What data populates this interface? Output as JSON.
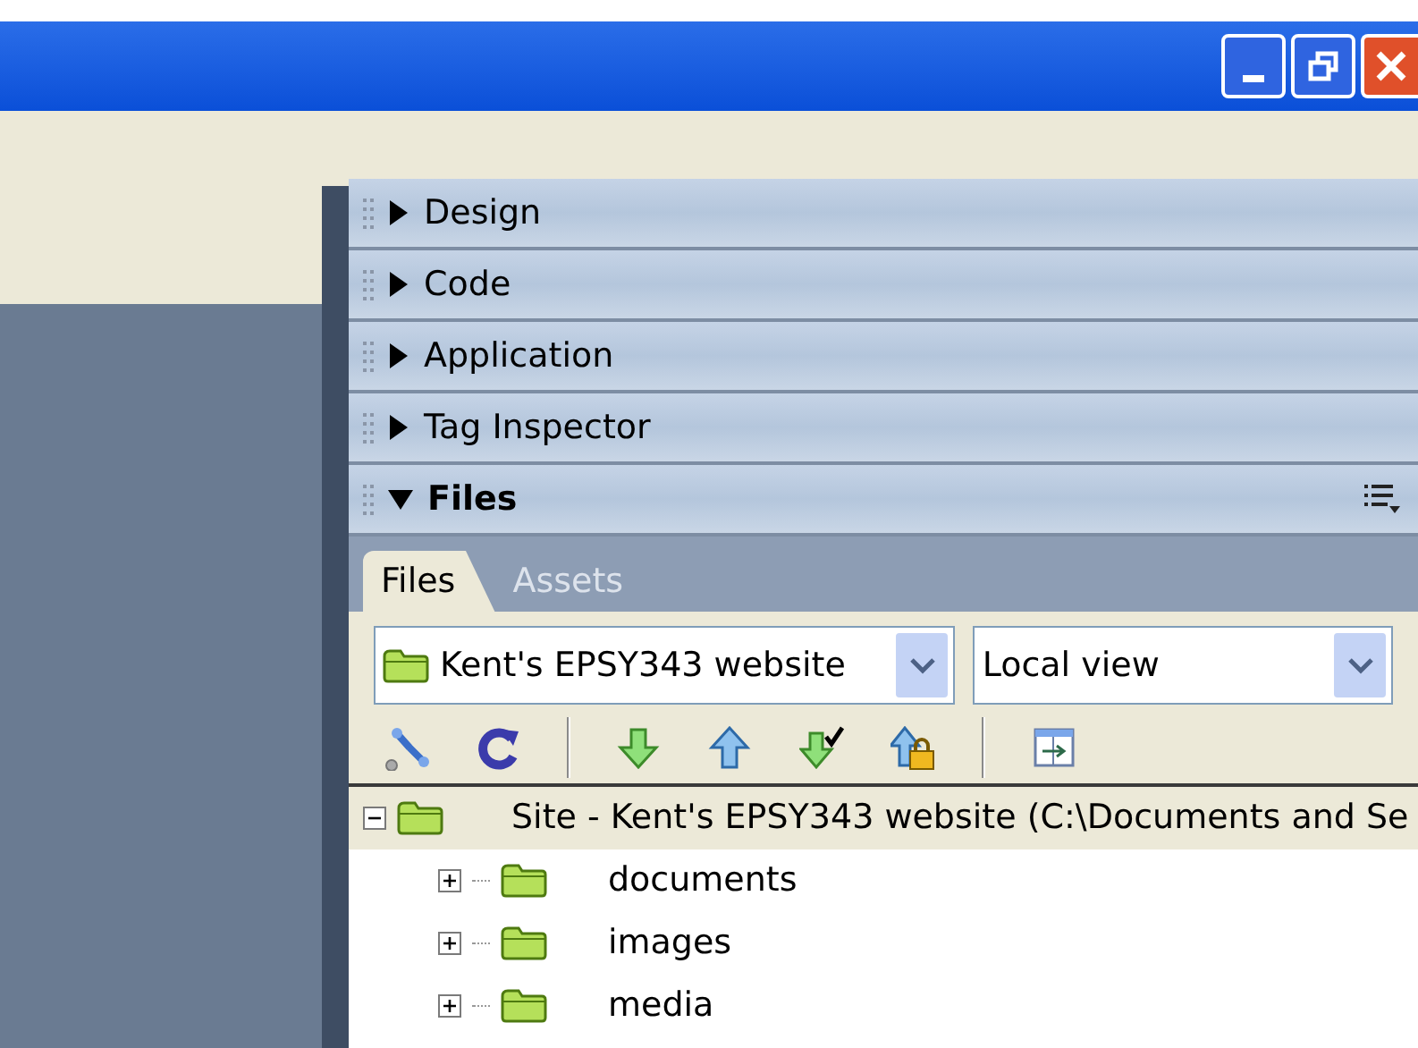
{
  "panels": [
    {
      "label": "Design",
      "expanded": false
    },
    {
      "label": "Code",
      "expanded": false
    },
    {
      "label": "Application",
      "expanded": false
    },
    {
      "label": "Tag Inspector",
      "expanded": false
    },
    {
      "label": "Files",
      "expanded": true
    }
  ],
  "tabs": [
    {
      "label": "Files",
      "selected": true
    },
    {
      "label": "Assets",
      "selected": false
    }
  ],
  "site_select": {
    "value": "Kent's EPSY343 website"
  },
  "view_select": {
    "value": "Local view"
  },
  "tree": [
    {
      "label": "Site - Kent's EPSY343 website (C:\\Documents and Se",
      "expanded": true,
      "selected": true,
      "children": [
        {
          "label": "documents",
          "expanded": false,
          "selected": false
        },
        {
          "label": "images",
          "expanded": false,
          "selected": false
        },
        {
          "label": "media",
          "expanded": false,
          "selected": false
        }
      ]
    }
  ]
}
